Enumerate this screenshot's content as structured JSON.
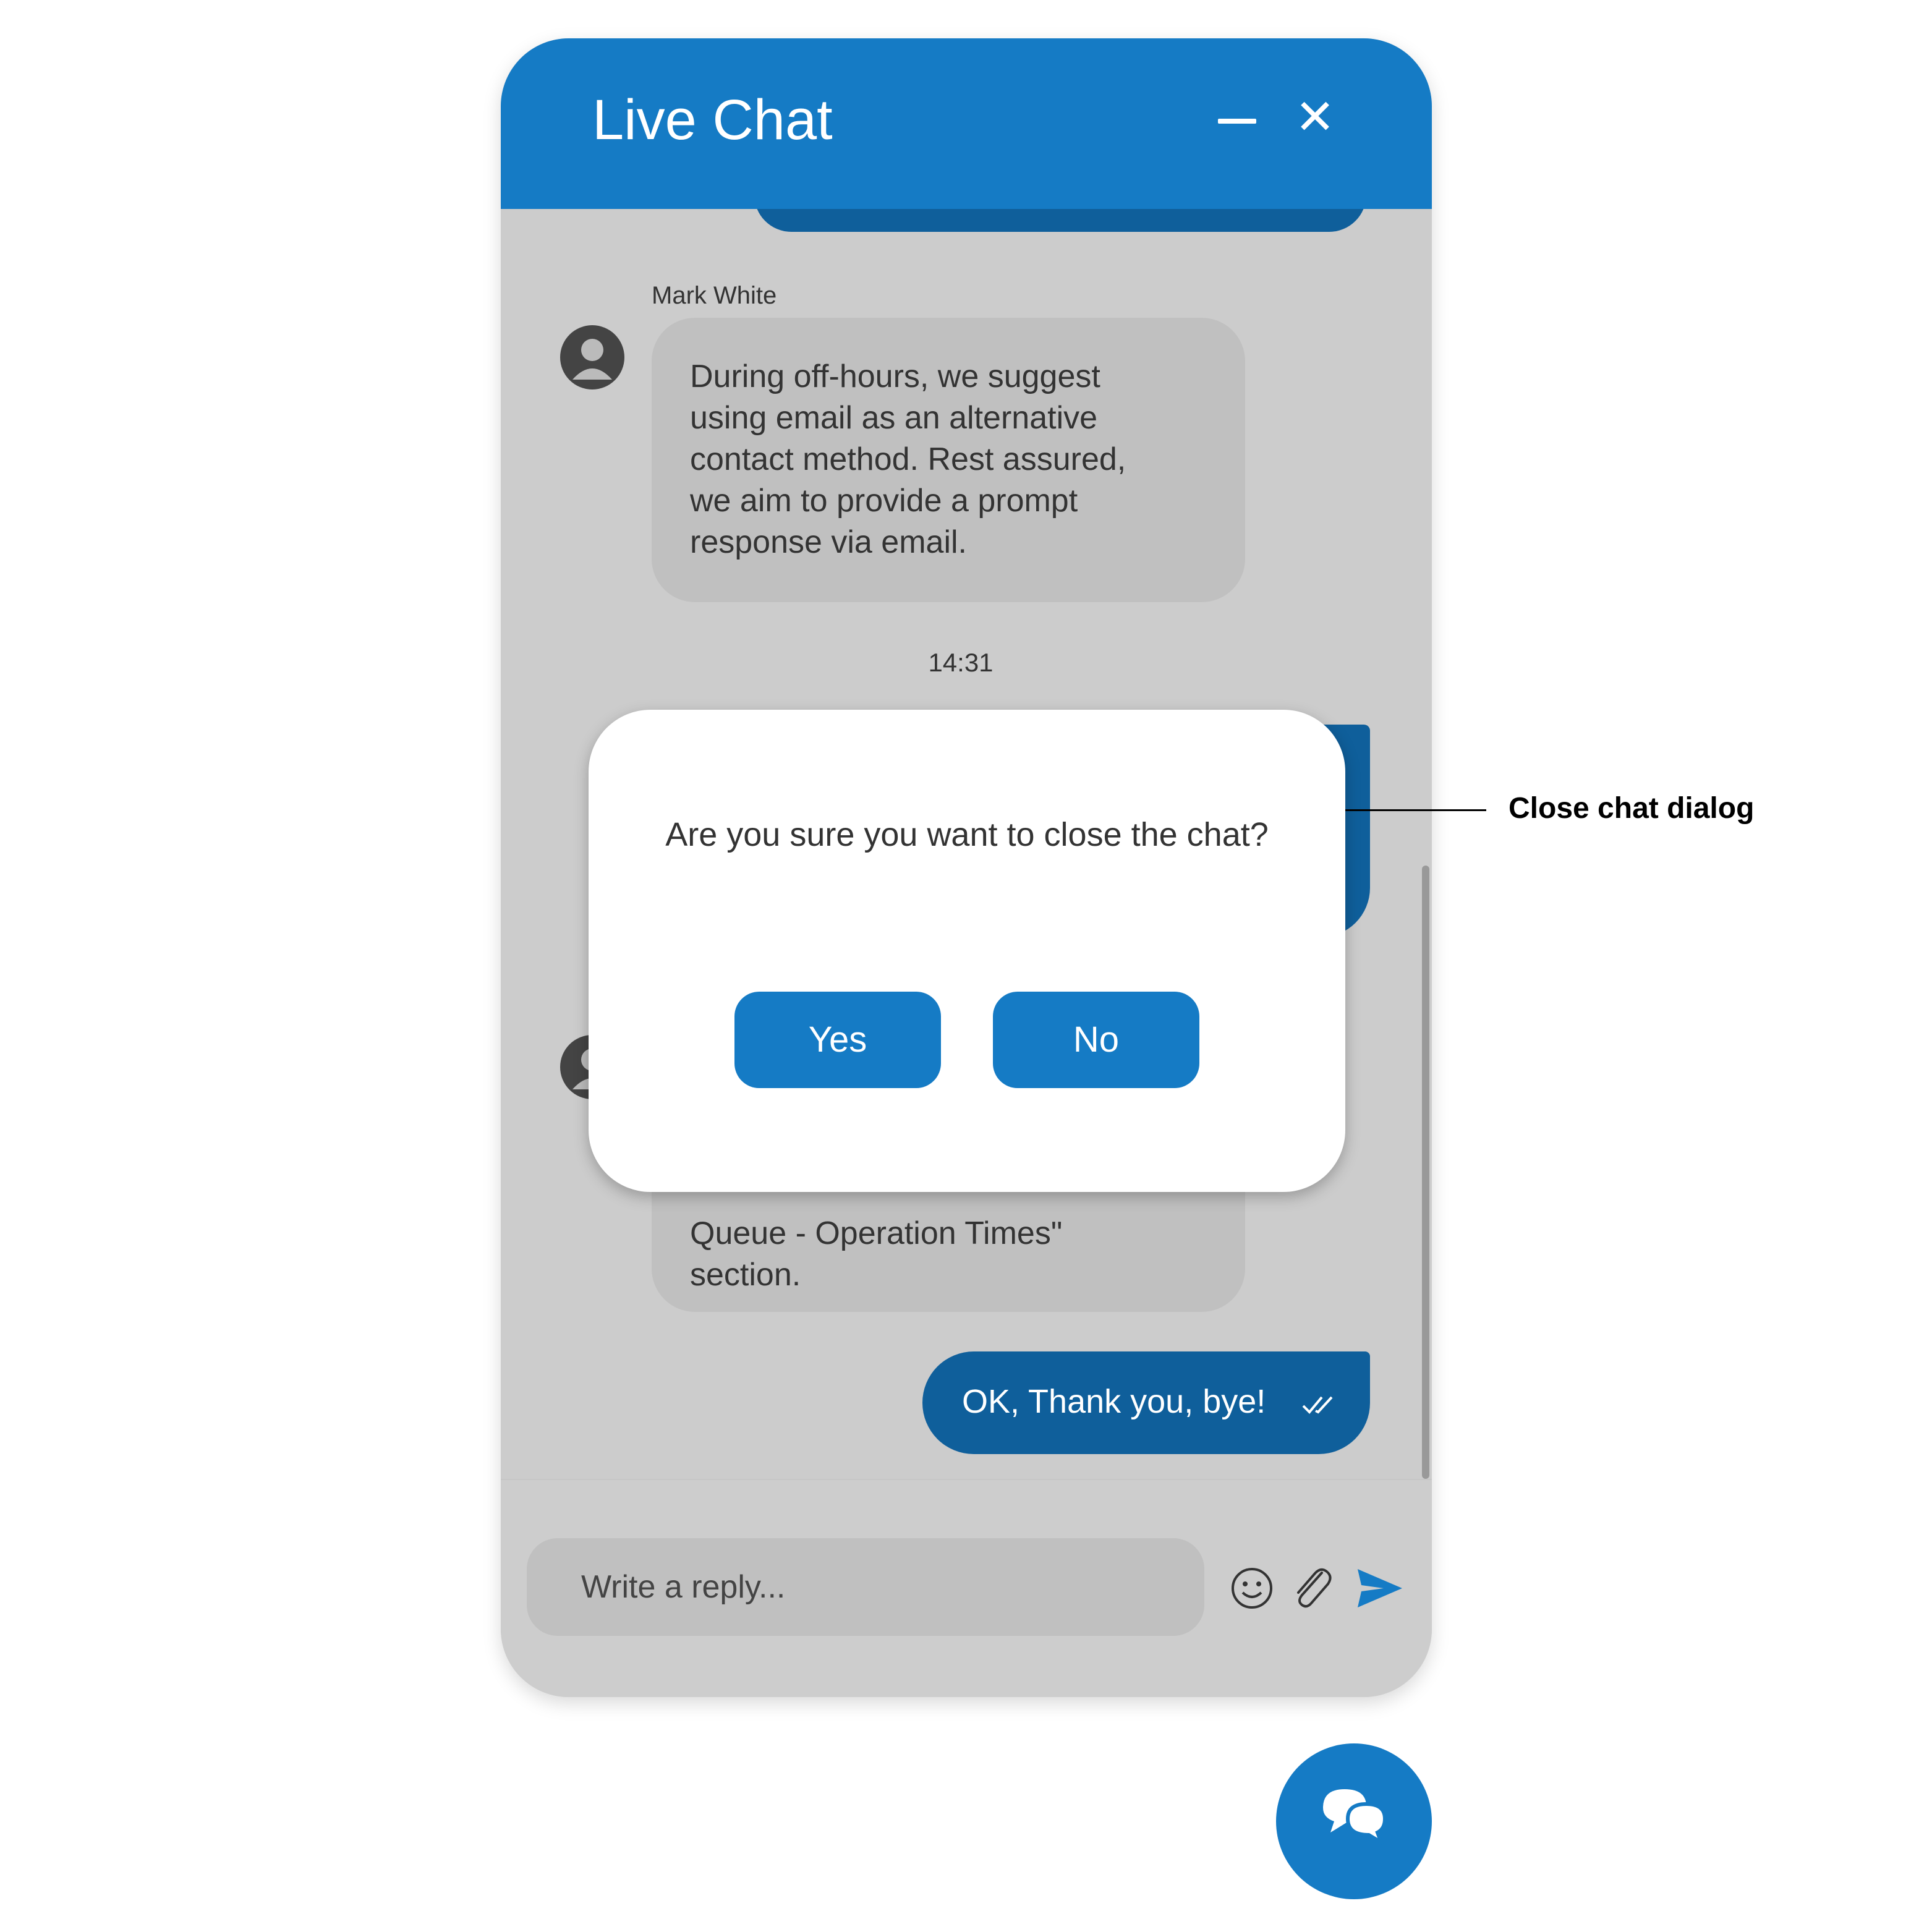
{
  "header": {
    "title": "Live Chat",
    "minimize_icon": "minimize-icon",
    "close_icon": "close-icon"
  },
  "messages": [
    {
      "sender": "Mark White",
      "text_lines": [
        "During off-hours, we suggest",
        "using email as an alternative",
        "contact method. Rest assured,",
        "we aim to provide a prompt",
        "response via email."
      ]
    },
    {
      "timestamp": "14:31"
    },
    {
      "text_lines": [
        "Queue - Operation Times\"",
        "section."
      ]
    },
    {
      "text": "OK, Thank you, bye!",
      "status_icon": "double-check-icon"
    }
  ],
  "dialog": {
    "text": "Are you sure you want to close the chat?",
    "yes_label": "Yes",
    "no_label": "No"
  },
  "composer": {
    "placeholder": "Write a reply...",
    "icons": [
      "emoji-icon",
      "attachment-icon",
      "send-icon"
    ]
  },
  "fab": {
    "icon": "chat-bubbles-icon"
  },
  "annotation": {
    "label": "Close chat dialog"
  },
  "colors": {
    "brand": "#157bc5",
    "sent_bubble": "#0f5f9b",
    "body": "#cccccc",
    "received_bubble": "#c0c0c0"
  }
}
